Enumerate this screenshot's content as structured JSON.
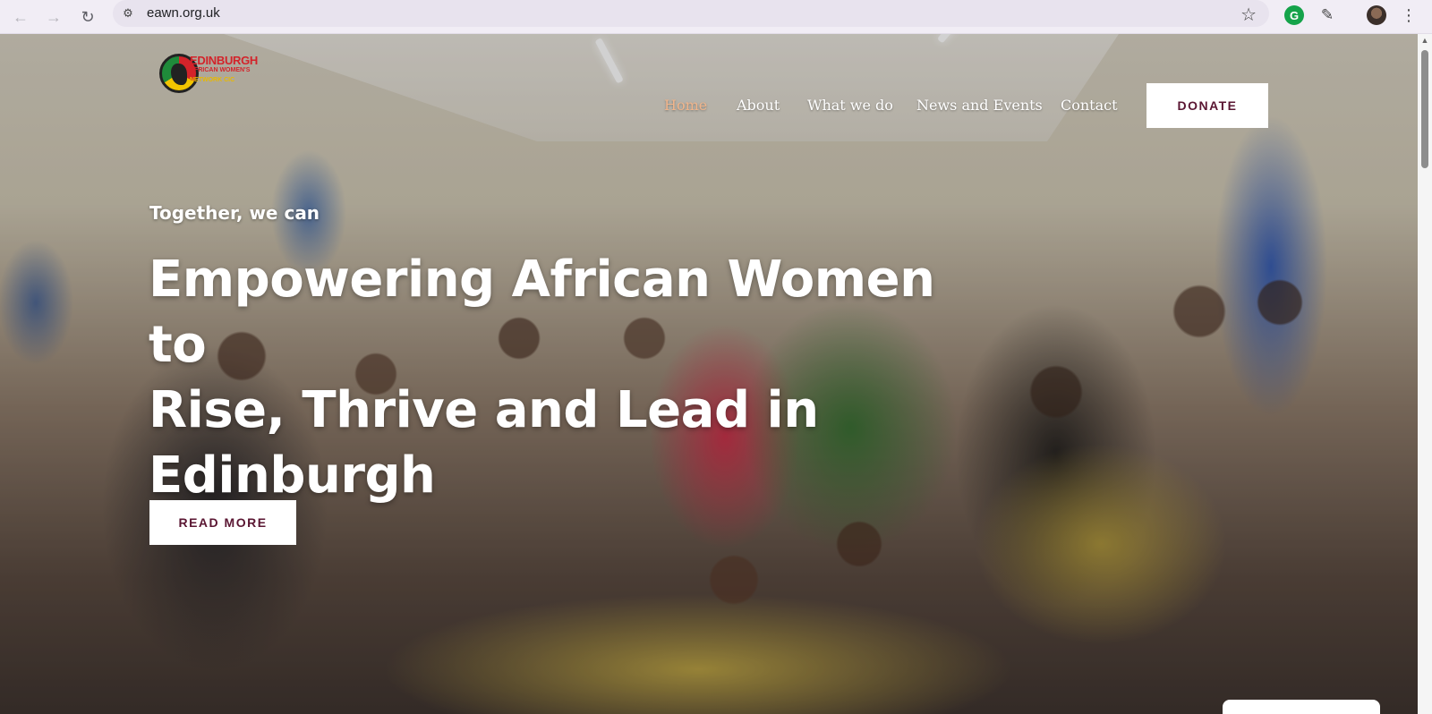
{
  "browser": {
    "url": "eawn.org.uk",
    "icons": {
      "back": "arrow-left-icon",
      "forward": "arrow-right-icon",
      "reload": "reload-icon",
      "site_info": "site-settings-icon",
      "bookmark": "star-icon",
      "extension_grammarly": "grammarly-icon",
      "extensions": "puzzle-icon",
      "profile": "avatar",
      "menu": "more-vert-icon"
    }
  },
  "site": {
    "logo_lines": [
      "EDINBURGH",
      "AFRICAN WOMEN'S",
      "NETWORK CIC"
    ],
    "nav": [
      {
        "label": "Home",
        "active": true
      },
      {
        "label": "About",
        "active": false
      },
      {
        "label": "What we do",
        "active": false
      },
      {
        "label": "News and Events",
        "active": false
      },
      {
        "label": "Contact",
        "active": false
      }
    ],
    "donate_label": "DONATE",
    "colors": {
      "accent_active": "#f0b58c",
      "button_text": "#5a1632"
    }
  },
  "hero": {
    "kicker": "Together, we can",
    "title_lines": [
      "Empowering African Women to",
      "Rise, Thrive and Lead in",
      "Edinburgh"
    ],
    "cta_label": "READ MORE"
  }
}
